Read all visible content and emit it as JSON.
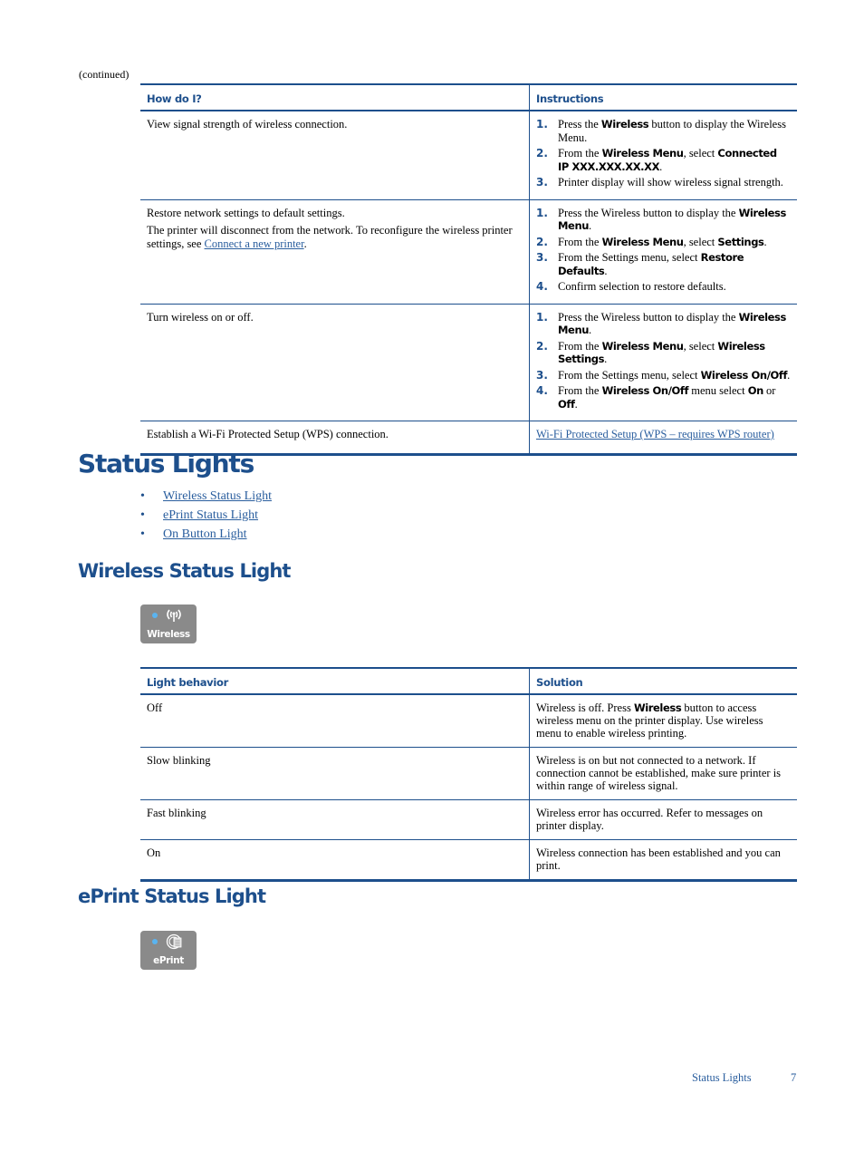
{
  "continued_label": "(continued)",
  "howto_table": {
    "headers": [
      "How do I?",
      "Instructions"
    ],
    "rows": [
      {
        "question": [
          "View signal strength of wireless connection."
        ],
        "steps": [
          [
            "Press the ",
            {
              "b": "Wireless"
            },
            " button to display the Wireless Menu."
          ],
          [
            "From the ",
            {
              "b": "Wireless Menu"
            },
            ", select ",
            {
              "b": "Connected IP XXX.XXX.XX.XX"
            },
            "."
          ],
          [
            "Printer display will show wireless signal strength."
          ]
        ]
      },
      {
        "question": [
          "Restore network settings to default settings.",
          "The printer will disconnect from the network. To reconfigure the wireless printer settings, see "
        ],
        "question_link": "Connect a new printer",
        "steps": [
          [
            "Press the Wireless button to display the ",
            {
              "b": "Wireless Menu"
            },
            "."
          ],
          [
            "From the ",
            {
              "b": "Wireless Menu"
            },
            ", select ",
            {
              "b": "Settings"
            },
            "."
          ],
          [
            "From the Settings menu, select ",
            {
              "b": "Restore Defaults"
            },
            "."
          ],
          [
            "Confirm selection to restore defaults."
          ]
        ]
      },
      {
        "question": [
          "Turn wireless on or off."
        ],
        "steps": [
          [
            "Press the Wireless button to display the ",
            {
              "b": "Wireless Menu"
            },
            "."
          ],
          [
            "From the ",
            {
              "b": "Wireless Menu"
            },
            ", select ",
            {
              "b": "Wireless Settings"
            },
            "."
          ],
          [
            "From the Settings menu, select ",
            {
              "b": "Wireless On/Off"
            },
            "."
          ],
          [
            "From the ",
            {
              "b": "Wireless On/Off"
            },
            " menu select ",
            {
              "b": "On"
            },
            " or ",
            {
              "b": "Off"
            },
            "."
          ]
        ]
      },
      {
        "question": [
          "Establish a Wi-Fi Protected Setup (WPS) connection."
        ],
        "instruction_link": "Wi-Fi Protected Setup (WPS – requires WPS router)"
      }
    ]
  },
  "section_title": "Status Lights",
  "toc": [
    "Wireless Status Light",
    "ePrint Status Light",
    "On Button Light"
  ],
  "wireless_section": {
    "title": "Wireless Status Light",
    "button_label": "Wireless",
    "button_icon": "wireless-antenna-icon",
    "indicator_color": "#5ab4f0"
  },
  "light_table": {
    "headers": [
      "Light behavior",
      "Solution"
    ],
    "rows": [
      {
        "behavior": "Off",
        "solution": [
          "Wireless is off. Press ",
          {
            "b": "Wireless"
          },
          " button to access wireless menu on the printer display. Use wireless menu to enable wireless printing."
        ]
      },
      {
        "behavior": "Slow blinking",
        "solution": [
          "Wireless is on but not connected to a network. If connection cannot be established, make sure printer is within range of wireless signal."
        ]
      },
      {
        "behavior": "Fast blinking",
        "solution": [
          "Wireless error has occurred. Refer to messages on printer display."
        ]
      },
      {
        "behavior": "On",
        "solution": [
          "Wireless connection has been established and you can print."
        ]
      }
    ]
  },
  "eprint_section": {
    "title": "ePrint Status Light",
    "button_label": "ePrint",
    "button_icon": "eprint-icon"
  },
  "footer": {
    "section": "Status Lights",
    "page_number": "7"
  },
  "colors": {
    "brand_blue": "#1d4f8c",
    "link_blue": "#2a5e9e",
    "button_gray": "#8a8a8a"
  }
}
